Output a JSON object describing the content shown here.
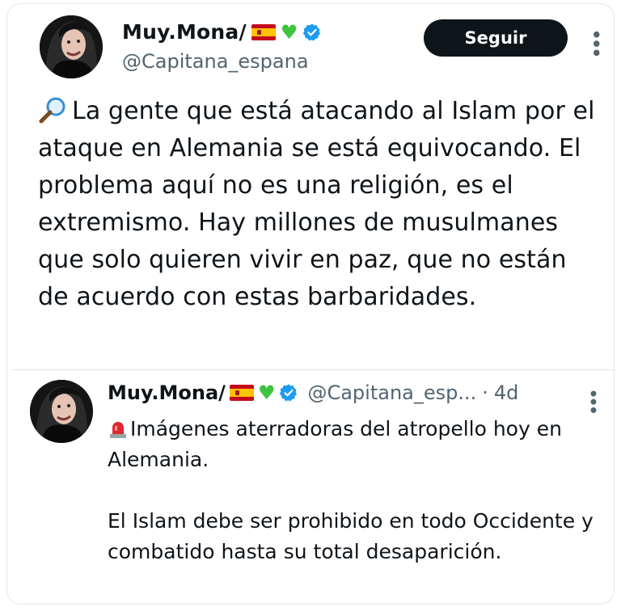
{
  "tweet": {
    "display_name": "Muy.Mona/",
    "handle": "@Capitana_espana",
    "follow_label": "Seguir",
    "text": "La gente que está atacando al Islam por el ataque en Alemania se está equivocando. El problema aquí no es una religión, es el extremismo. Hay millones de musulmanes que solo quieren vivir en paz, que no están de acuerdo con estas barbaridades.",
    "icons": [
      "magnifying-glass-icon",
      "spain-flag-icon",
      "green-heart-icon",
      "verified-badge-icon",
      "more-options-icon"
    ]
  },
  "quoted_tweet": {
    "display_name": "Muy.Mona/",
    "handle": "@Capitana_esp...",
    "separator": "·",
    "time": "4d",
    "paragraph_1": "Imágenes aterradoras del atropello hoy en Alemania.",
    "paragraph_2": "El Islam debe ser prohibido en todo Occidente y combatido hasta su total desaparición.",
    "icons": [
      "siren-icon",
      "spain-flag-icon",
      "green-heart-icon",
      "verified-badge-icon",
      "more-options-icon"
    ]
  },
  "colors": {
    "text": "#0f1419",
    "secondary_text": "#536471",
    "button_bg": "#0f1419",
    "verified_blue": "#1d9bf0",
    "heart_green": "#3ec43e"
  }
}
